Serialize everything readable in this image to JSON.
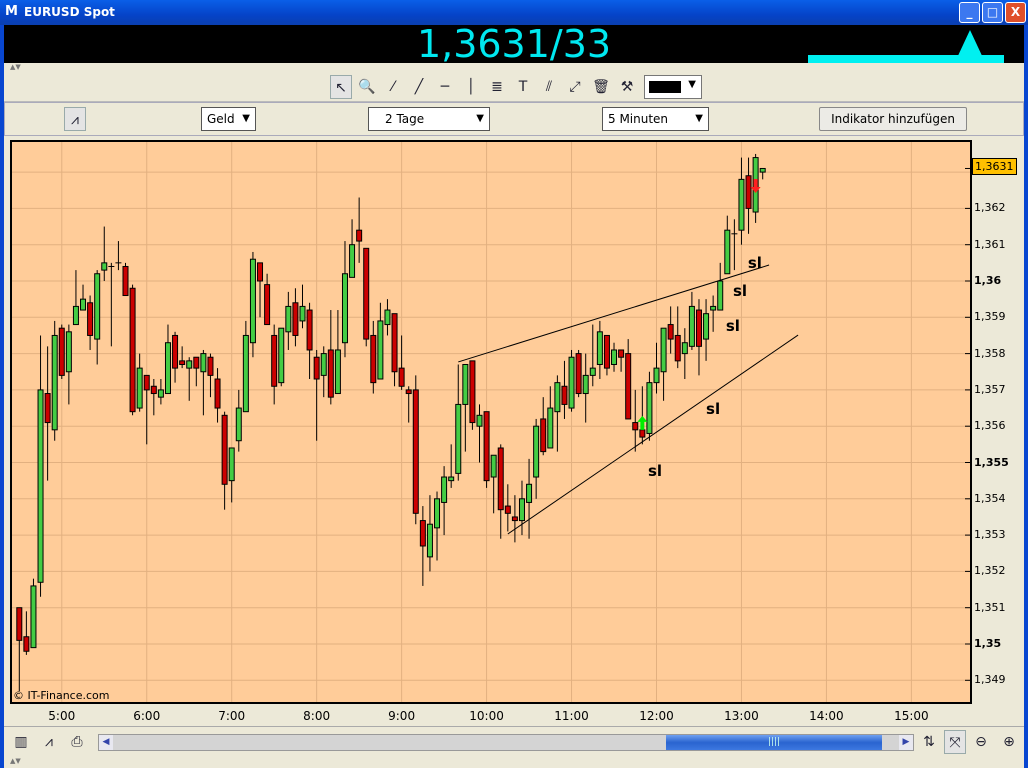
{
  "window": {
    "title": "EURUSD Spot",
    "logo": "M",
    "minimize": "_",
    "maximize": "□",
    "close": "X"
  },
  "quote": {
    "price": "1,3631/33",
    "trend": "up"
  },
  "drawing_toolbar": {
    "tools": [
      {
        "name": "pointer-icon",
        "glyph": "↖"
      },
      {
        "name": "zoom-in-icon",
        "glyph": "🔍"
      },
      {
        "name": "line-segment-icon",
        "glyph": "⁄"
      },
      {
        "name": "trend-line-icon",
        "glyph": "╱"
      },
      {
        "name": "horizontal-line-icon",
        "glyph": "─"
      },
      {
        "name": "vertical-line-icon",
        "glyph": "│"
      },
      {
        "name": "fibonacci-icon",
        "glyph": "≣"
      },
      {
        "name": "text-tool-icon",
        "glyph": "T"
      },
      {
        "name": "parallel-lines-icon",
        "glyph": "⫽"
      },
      {
        "name": "channel-icon",
        "glyph": "⤢"
      },
      {
        "name": "trash-icon",
        "glyph": "🗑"
      },
      {
        "name": "tools-settings-icon",
        "glyph": "⚒"
      }
    ],
    "color_value": "#000000"
  },
  "settings_toolbar": {
    "price_type": "Geld",
    "range": "2 Tage",
    "interval": "5 Minuten",
    "add_indicator": "Indikator hinzufügen"
  },
  "footer": {
    "copyright": "© IT-Finance.com"
  },
  "colors": {
    "background": "#FFCC99",
    "grid": "#E2B080",
    "up": "#44CC44",
    "down": "#CC0000",
    "price_tag": "#FFC000"
  },
  "chart_data": {
    "type": "candlestick",
    "title": "EURUSD Spot",
    "interval_minutes": 5,
    "start_time": "04:30",
    "ylim": [
      1.3485,
      1.364
    ],
    "y_ticks": [
      {
        "v": 1.362,
        "label": "1,362"
      },
      {
        "v": 1.361,
        "label": "1,361"
      },
      {
        "v": 1.36,
        "label": "1,36",
        "bold": true
      },
      {
        "v": 1.359,
        "label": "1,359"
      },
      {
        "v": 1.358,
        "label": "1,358"
      },
      {
        "v": 1.357,
        "label": "1,357"
      },
      {
        "v": 1.356,
        "label": "1,356"
      },
      {
        "v": 1.355,
        "label": "1,355",
        "bold": true
      },
      {
        "v": 1.354,
        "label": "1,354"
      },
      {
        "v": 1.353,
        "label": "1,353"
      },
      {
        "v": 1.352,
        "label": "1,352"
      },
      {
        "v": 1.351,
        "label": "1,351"
      },
      {
        "v": 1.35,
        "label": "1,35",
        "bold": true
      },
      {
        "v": 1.349,
        "label": "1,349"
      }
    ],
    "x_ticks": [
      "5:00",
      "6:00",
      "7:00",
      "8:00",
      "9:00",
      "10:00",
      "11:00",
      "12:00",
      "13:00",
      "14:00",
      "15:00"
    ],
    "current_price": {
      "v": 1.3631,
      "label": "1,3631"
    },
    "ohlc": [
      [
        1.351,
        1.351,
        1.3487,
        1.3501
      ],
      [
        1.3502,
        1.3509,
        1.3497,
        1.3498
      ],
      [
        1.3499,
        1.3518,
        1.3499,
        1.3516
      ],
      [
        1.3517,
        1.3585,
        1.3513,
        1.357
      ],
      [
        1.3569,
        1.3582,
        1.3545,
        1.3561
      ],
      [
        1.3559,
        1.3589,
        1.3556,
        1.3585
      ],
      [
        1.3587,
        1.3588,
        1.3573,
        1.3574
      ],
      [
        1.3575,
        1.3588,
        1.3566,
        1.3586
      ],
      [
        1.3588,
        1.3603,
        1.3589,
        1.3593
      ],
      [
        1.3592,
        1.3599,
        1.3592,
        1.3595
      ],
      [
        1.3594,
        1.3596,
        1.3581,
        1.3585
      ],
      [
        1.3584,
        1.3603,
        1.3577,
        1.3602
      ],
      [
        1.3603,
        1.3615,
        1.36,
        1.3605
      ],
      [
        1.3604,
        1.3605,
        1.3582,
        1.3604
      ],
      [
        1.3605,
        1.3611,
        1.3603,
        1.3605
      ],
      [
        1.3604,
        1.3605,
        1.3596,
        1.3596
      ],
      [
        1.3598,
        1.3599,
        1.3563,
        1.3564
      ],
      [
        1.3565,
        1.358,
        1.3564,
        1.3576
      ],
      [
        1.3574,
        1.3574,
        1.3555,
        1.357
      ],
      [
        1.3571,
        1.3573,
        1.3563,
        1.3569
      ],
      [
        1.3568,
        1.3573,
        1.3566,
        1.357
      ],
      [
        1.3569,
        1.3588,
        1.3569,
        1.3583
      ],
      [
        1.3585,
        1.3586,
        1.3572,
        1.3576
      ],
      [
        1.3578,
        1.3582,
        1.3576,
        1.3577
      ],
      [
        1.3576,
        1.3579,
        1.3567,
        1.3578
      ],
      [
        1.3579,
        1.3579,
        1.3571,
        1.3576
      ],
      [
        1.3575,
        1.3581,
        1.3563,
        1.358
      ],
      [
        1.3579,
        1.358,
        1.3568,
        1.3574
      ],
      [
        1.3573,
        1.3576,
        1.3561,
        1.3565
      ],
      [
        1.3563,
        1.3564,
        1.3537,
        1.3544
      ],
      [
        1.3545,
        1.3554,
        1.3539,
        1.3554
      ],
      [
        1.3556,
        1.357,
        1.3553,
        1.3565
      ],
      [
        1.3564,
        1.3589,
        1.3564,
        1.3585
      ],
      [
        1.3583,
        1.3608,
        1.3579,
        1.3606
      ],
      [
        1.3605,
        1.3605,
        1.359,
        1.36
      ],
      [
        1.3599,
        1.3602,
        1.3588,
        1.3588
      ],
      [
        1.3585,
        1.3588,
        1.3566,
        1.3571
      ],
      [
        1.3572,
        1.3587,
        1.3571,
        1.3587
      ],
      [
        1.3586,
        1.3597,
        1.3581,
        1.3593
      ],
      [
        1.3594,
        1.3598,
        1.3582,
        1.3585
      ],
      [
        1.3589,
        1.3599,
        1.3587,
        1.3593
      ],
      [
        1.3592,
        1.3594,
        1.3573,
        1.3581
      ],
      [
        1.3579,
        1.3581,
        1.3556,
        1.3573
      ],
      [
        1.3574,
        1.3582,
        1.3568,
        1.358
      ],
      [
        1.3581,
        1.3592,
        1.3566,
        1.3568
      ],
      [
        1.3569,
        1.3592,
        1.3569,
        1.3581
      ],
      [
        1.3583,
        1.3611,
        1.3579,
        1.3602
      ],
      [
        1.3601,
        1.3617,
        1.3601,
        1.361
      ],
      [
        1.3614,
        1.3623,
        1.3605,
        1.3611
      ],
      [
        1.3609,
        1.3609,
        1.3582,
        1.3584
      ],
      [
        1.3585,
        1.3589,
        1.3569,
        1.3572
      ],
      [
        1.3573,
        1.3594,
        1.3573,
        1.3589
      ],
      [
        1.3588,
        1.3595,
        1.3585,
        1.3592
      ],
      [
        1.3591,
        1.3591,
        1.3571,
        1.3575
      ],
      [
        1.3576,
        1.3585,
        1.357,
        1.3571
      ],
      [
        1.357,
        1.3571,
        1.3561,
        1.3569
      ],
      [
        1.357,
        1.3574,
        1.3533,
        1.3536
      ],
      [
        1.3534,
        1.3538,
        1.3516,
        1.3527
      ],
      [
        1.3524,
        1.3541,
        1.352,
        1.3533
      ],
      [
        1.3532,
        1.3542,
        1.3523,
        1.354
      ],
      [
        1.3539,
        1.3549,
        1.353,
        1.3546
      ],
      [
        1.3545,
        1.3555,
        1.3543,
        1.3546
      ],
      [
        1.3547,
        1.3577,
        1.3545,
        1.3566
      ],
      [
        1.3566,
        1.3577,
        1.3553,
        1.3577
      ],
      [
        1.3578,
        1.3578,
        1.3559,
        1.3561
      ],
      [
        1.356,
        1.3566,
        1.355,
        1.3563
      ],
      [
        1.3564,
        1.3564,
        1.3543,
        1.3545
      ],
      [
        1.3546,
        1.3552,
        1.3536,
        1.3552
      ],
      [
        1.3554,
        1.3555,
        1.3529,
        1.3537
      ],
      [
        1.3538,
        1.3544,
        1.3531,
        1.3536
      ],
      [
        1.3535,
        1.3541,
        1.3528,
        1.3534
      ],
      [
        1.3534,
        1.3545,
        1.353,
        1.354
      ],
      [
        1.3539,
        1.3551,
        1.3529,
        1.3544
      ],
      [
        1.3546,
        1.3562,
        1.354,
        1.356
      ],
      [
        1.3562,
        1.3568,
        1.3552,
        1.3553
      ],
      [
        1.3554,
        1.3571,
        1.3554,
        1.3565
      ],
      [
        1.3564,
        1.3574,
        1.3553,
        1.3572
      ],
      [
        1.3571,
        1.3578,
        1.3562,
        1.3566
      ],
      [
        1.3565,
        1.3581,
        1.3564,
        1.3579
      ],
      [
        1.358,
        1.3581,
        1.3568,
        1.3569
      ],
      [
        1.3569,
        1.358,
        1.3561,
        1.3574
      ],
      [
        1.3574,
        1.3588,
        1.3571,
        1.3576
      ],
      [
        1.3577,
        1.3589,
        1.3573,
        1.3586
      ],
      [
        1.3585,
        1.3585,
        1.3574,
        1.3576
      ],
      [
        1.3577,
        1.3583,
        1.3575,
        1.3581
      ],
      [
        1.3581,
        1.3581,
        1.3575,
        1.3579
      ],
      [
        1.358,
        1.3584,
        1.3562,
        1.3562
      ],
      [
        1.3561,
        1.357,
        1.3553,
        1.3559
      ],
      [
        1.3559,
        1.3571,
        1.3555,
        1.3557
      ],
      [
        1.3558,
        1.3575,
        1.3556,
        1.3572
      ],
      [
        1.3572,
        1.3583,
        1.3569,
        1.3576
      ],
      [
        1.3575,
        1.3587,
        1.3567,
        1.3587
      ],
      [
        1.3588,
        1.3593,
        1.358,
        1.3584
      ],
      [
        1.3585,
        1.3593,
        1.3576,
        1.3578
      ],
      [
        1.358,
        1.3587,
        1.3573,
        1.3583
      ],
      [
        1.3582,
        1.3597,
        1.3581,
        1.3593
      ],
      [
        1.3592,
        1.3595,
        1.3574,
        1.3582
      ],
      [
        1.3584,
        1.3595,
        1.3578,
        1.3591
      ],
      [
        1.3592,
        1.3596,
        1.3586,
        1.3593
      ],
      [
        1.3592,
        1.3605,
        1.3592,
        1.36
      ],
      [
        1.3602,
        1.3618,
        1.3602,
        1.3614
      ],
      [
        1.3613,
        1.3617,
        1.3603,
        1.3613
      ],
      [
        1.3614,
        1.3634,
        1.361,
        1.3628
      ],
      [
        1.3629,
        1.3634,
        1.3613,
        1.362
      ],
      [
        1.3619,
        1.3635,
        1.3616,
        1.3634
      ],
      [
        1.363,
        1.3631,
        1.3628,
        1.3631
      ]
    ],
    "trend_lines": [
      {
        "from": {
          "i": 62,
          "p": 1.35777
        },
        "to": {
          "i": 105.9,
          "p": 1.36044
        }
      },
      {
        "from": {
          "i": 69,
          "p": 1.35303
        },
        "to": {
          "i": 110,
          "p": 1.35851
        }
      }
    ],
    "signals": [
      {
        "i": 88,
        "dir": "buy",
        "p": 1.3559
      },
      {
        "i": 104,
        "dir": "sell",
        "p": 1.3627
      }
    ],
    "annotations": [
      {
        "text": "sl",
        "i": 102.9,
        "p": 1.36052
      },
      {
        "text": "sl",
        "i": 100.8,
        "p": 1.35975
      },
      {
        "text": "sl",
        "i": 99.8,
        "p": 1.35879
      },
      {
        "text": "sl",
        "i": 97,
        "p": 1.3565
      },
      {
        "text": "sl",
        "i": 88.8,
        "p": 1.3548
      }
    ]
  }
}
